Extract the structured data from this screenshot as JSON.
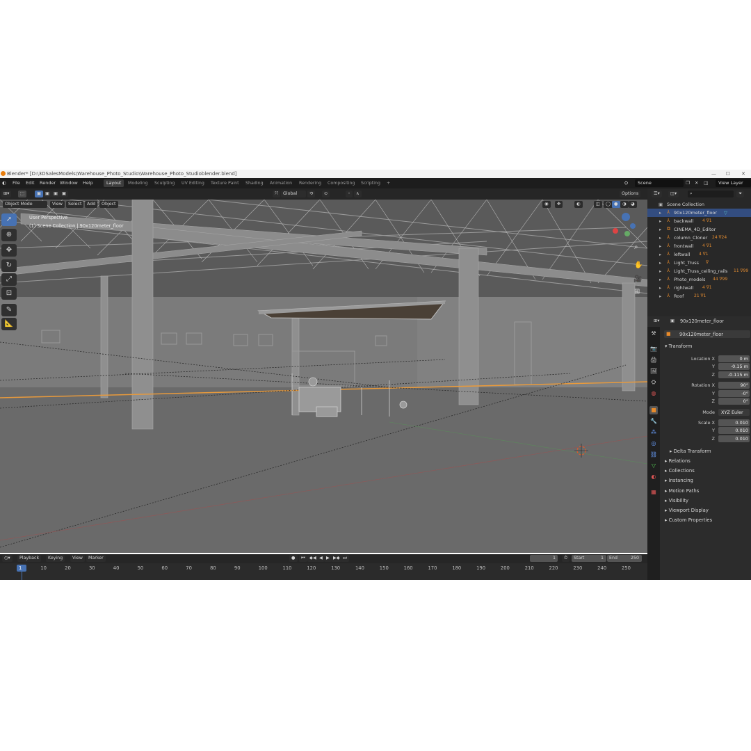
{
  "window": {
    "title": "Blender* [D:\\3DSalesModels\\Warehouse_Photo_Studio\\Warehouse_Photo_Studioblender.blend]",
    "min": "—",
    "max": "☐",
    "close": "✕"
  },
  "menu": [
    "File",
    "Edit",
    "Render",
    "Window",
    "Help"
  ],
  "workspaces": [
    "Layout",
    "Modeling",
    "Sculpting",
    "UV Editing",
    "Texture Paint",
    "Shading",
    "Animation",
    "Rendering",
    "Compositing",
    "Scripting"
  ],
  "add_workspace": "+",
  "scene": {
    "label": "Scene",
    "view_layer": "View Layer"
  },
  "viewport_header": {
    "transform": "Global",
    "options": "Options"
  },
  "viewport_menu": {
    "mode": "Object Mode",
    "items": [
      "View",
      "Select",
      "Add",
      "Object"
    ]
  },
  "viewport_overlay": {
    "perspective": "User Perspective",
    "collection_info": "(1) Scene Collection | 90x120meter_floor"
  },
  "outliner": {
    "root": "Scene Collection",
    "items": [
      {
        "name": "90x120meter_floor",
        "extra": "",
        "selected": true
      },
      {
        "name": "backwall",
        "extra": "4  ∇1"
      },
      {
        "name": "CINEMA_4D_Editor",
        "extra": ""
      },
      {
        "name": "column_Cloner",
        "extra": "24 ∇24"
      },
      {
        "name": "frontwall",
        "extra": "4  ∇1"
      },
      {
        "name": "leftwall",
        "extra": "4  ∇1"
      },
      {
        "name": "Light_Truss",
        "extra": "∇"
      },
      {
        "name": "Light_Truss_ceiling_rails",
        "extra": "11 ∇99"
      },
      {
        "name": "Photo_models",
        "extra": "44 ∇99"
      },
      {
        "name": "rightwall",
        "extra": "4  ∇1"
      },
      {
        "name": "Roof",
        "extra": "21 ∇1"
      }
    ]
  },
  "properties": {
    "object_header": "90x120meter_floor",
    "object_name": "90x120meter_floor",
    "transform_title": "Transform",
    "location": {
      "label": "Location X",
      "x": "0 m",
      "y_label": "Y",
      "y": "-0.15 m",
      "z_label": "Z",
      "z": "-0.115 m"
    },
    "rotation": {
      "label": "Rotation X",
      "x": "90°",
      "y_label": "Y",
      "y": "-0°",
      "z_label": "Z",
      "z": "0°"
    },
    "mode": {
      "label": "Mode",
      "value": "XYZ Euler"
    },
    "scale": {
      "label": "Scale X",
      "x": "0.010",
      "y_label": "Y",
      "y": "0.010",
      "z_label": "Z",
      "z": "0.010"
    },
    "delta": "Delta Transform",
    "sections": [
      "Relations",
      "Collections",
      "Instancing",
      "Motion Paths",
      "Visibility",
      "Viewport Display",
      "Custom Properties"
    ]
  },
  "timeline": {
    "menus": [
      "Playback",
      "Keying",
      "View",
      "Marker"
    ],
    "current_frame": "1",
    "start_label": "Start",
    "start": "1",
    "end_label": "End",
    "end": "250",
    "ticks": [
      "1",
      "10",
      "20",
      "30",
      "40",
      "50",
      "60",
      "70",
      "80",
      "90",
      "100",
      "110",
      "120",
      "130",
      "140",
      "150",
      "160",
      "170",
      "180",
      "190",
      "200",
      "210",
      "220",
      "230",
      "240",
      "250"
    ]
  },
  "colors": {
    "accent": "#4772b3",
    "selection": "#334d80",
    "object_orange": "#e88b2a",
    "bg_dark": "#1d1d1d"
  }
}
